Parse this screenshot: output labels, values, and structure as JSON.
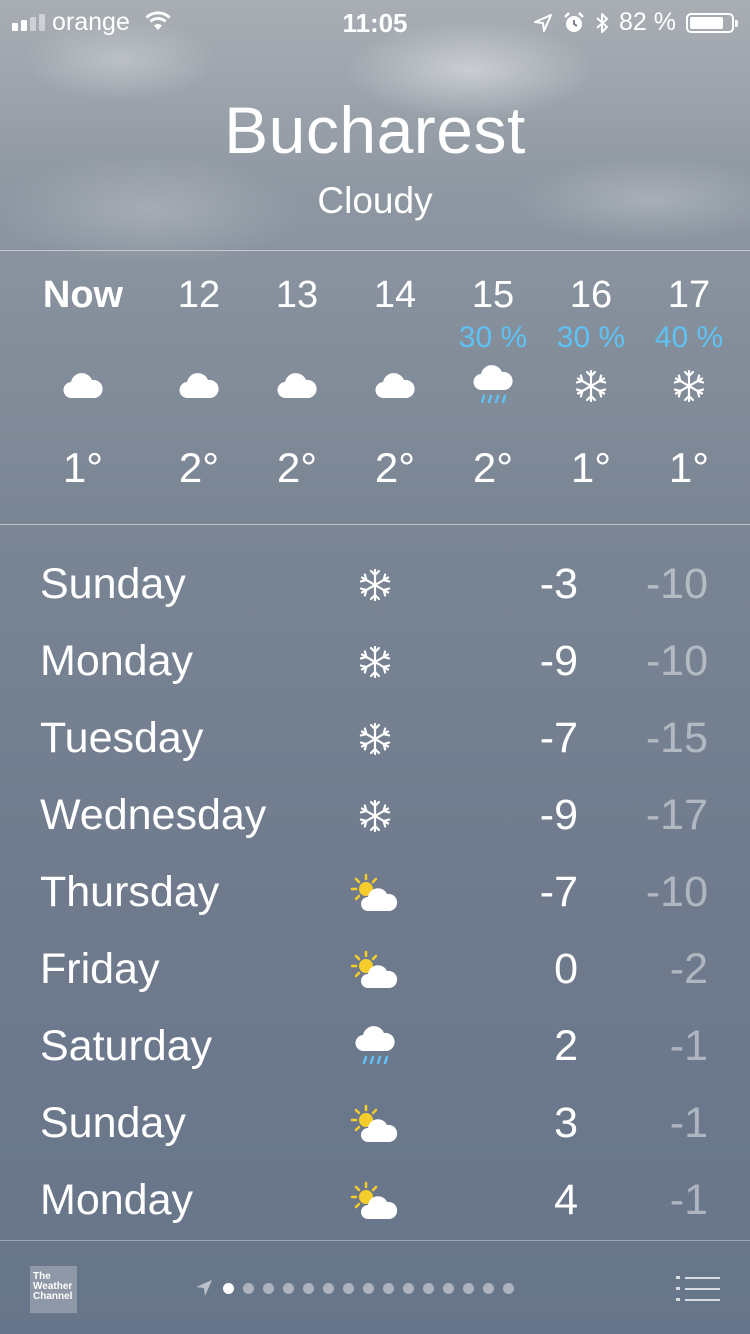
{
  "status_bar": {
    "carrier": "orange",
    "time": "11:05",
    "battery": "82 %",
    "battery_level": 0.82
  },
  "location": {
    "city": "Bucharest",
    "condition": "Cloudy"
  },
  "hourly": [
    {
      "time": "Now",
      "precip": "",
      "icon": "cloud-icon",
      "temp": "1°"
    },
    {
      "time": "12",
      "precip": "",
      "icon": "cloud-icon",
      "temp": "2°"
    },
    {
      "time": "13",
      "precip": "",
      "icon": "cloud-icon",
      "temp": "2°"
    },
    {
      "time": "14",
      "precip": "",
      "icon": "cloud-icon",
      "temp": "2°"
    },
    {
      "time": "15",
      "precip": "30 %",
      "icon": "rain-cloud-icon",
      "temp": "2°"
    },
    {
      "time": "16",
      "precip": "30 %",
      "icon": "snowflake-icon",
      "temp": "1°"
    },
    {
      "time": "17",
      "precip": "40 %",
      "icon": "snowflake-icon",
      "temp": "1°"
    }
  ],
  "daily": [
    {
      "day": "Sunday",
      "icon": "snowflake-icon",
      "high": "-3",
      "low": "-10"
    },
    {
      "day": "Monday",
      "icon": "snowflake-icon",
      "high": "-9",
      "low": "-10"
    },
    {
      "day": "Tuesday",
      "icon": "snowflake-icon",
      "high": "-7",
      "low": "-15"
    },
    {
      "day": "Wednesday",
      "icon": "snowflake-icon",
      "high": "-9",
      "low": "-17"
    },
    {
      "day": "Thursday",
      "icon": "partly-sunny-icon",
      "high": "-7",
      "low": "-10"
    },
    {
      "day": "Friday",
      "icon": "partly-sunny-icon",
      "high": "0",
      "low": "-2"
    },
    {
      "day": "Saturday",
      "icon": "rain-cloud-icon",
      "high": "2",
      "low": "-1"
    },
    {
      "day": "Sunday",
      "icon": "partly-sunny-icon",
      "high": "3",
      "low": "-1"
    },
    {
      "day": "Monday",
      "icon": "partly-sunny-icon",
      "high": "4",
      "low": "-1"
    }
  ],
  "footer": {
    "logo_text": "The Weather Channel",
    "page_count": 16,
    "active_page": 1
  },
  "colors": {
    "precip": "#5ec2f4",
    "sun": "#f5cd2b",
    "rain": "#5ec2f4"
  }
}
